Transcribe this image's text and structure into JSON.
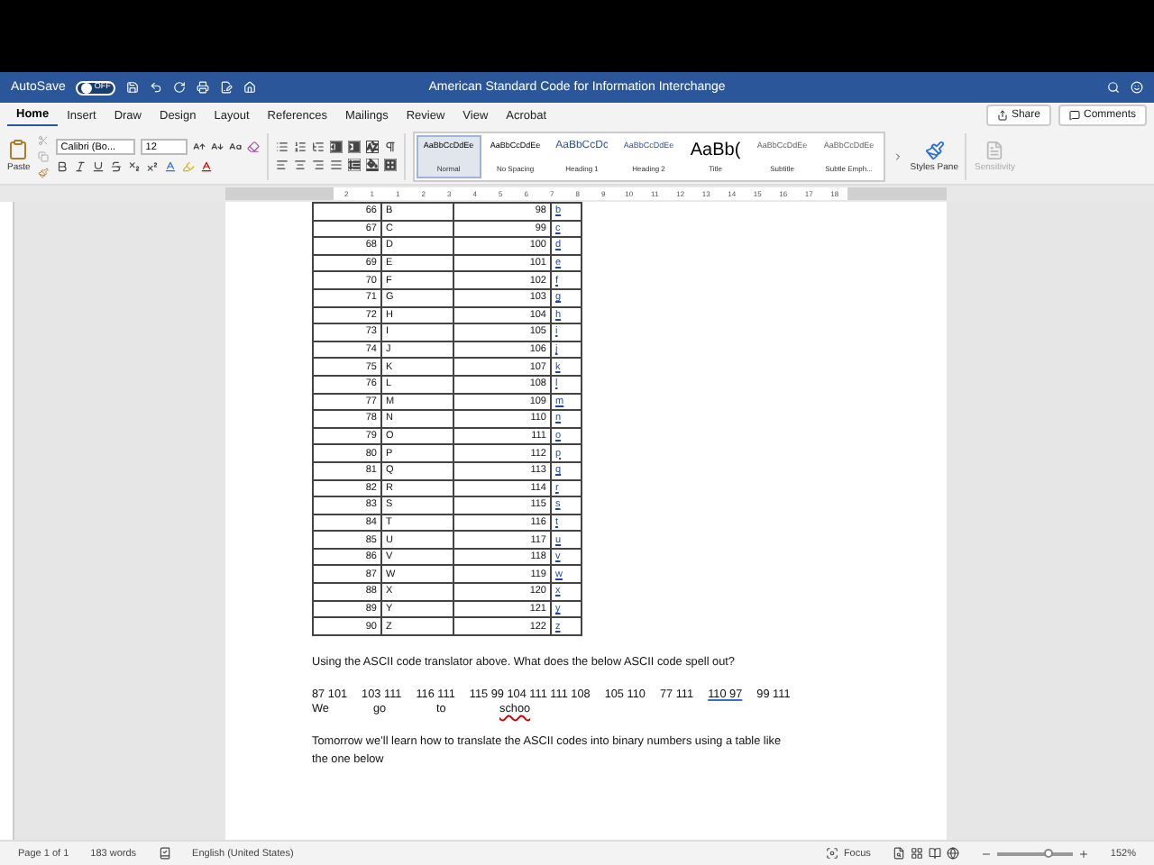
{
  "title_bar": {
    "autosave_label": "AutoSave",
    "autosave": {
      "on": false,
      "label": "OFF"
    },
    "title": "American Standard Code for Information Interchange"
  },
  "tabs": [
    {
      "label": "Home",
      "selected": true
    },
    {
      "label": "Insert",
      "selected": false
    },
    {
      "label": "Draw",
      "selected": false
    },
    {
      "label": "Design",
      "selected": false
    },
    {
      "label": "Layout",
      "selected": false
    },
    {
      "label": "References",
      "selected": false
    },
    {
      "label": "Mailings",
      "selected": false
    },
    {
      "label": "Review",
      "selected": false
    },
    {
      "label": "View",
      "selected": false
    },
    {
      "label": "Acrobat",
      "selected": false
    }
  ],
  "share_button": "Share",
  "comments_button": "Comments",
  "ribbon": {
    "paste_label": "Paste",
    "font_name": "Calibri (Bo...",
    "font_size": "12",
    "styles": [
      {
        "preview": "AaBbCcDdEe",
        "name": "Normal",
        "selected": true,
        "kind": "body"
      },
      {
        "preview": "AaBbCcDdEe",
        "name": "No Spacing",
        "selected": false,
        "kind": "body"
      },
      {
        "preview": "AaBbCcDc",
        "name": "Heading 1",
        "selected": false,
        "kind": "heading"
      },
      {
        "preview": "AaBbCcDdEe",
        "name": "Heading 2",
        "selected": false,
        "kind": "heading2"
      },
      {
        "preview": "AaBb(",
        "name": "Title",
        "selected": false,
        "kind": "title"
      },
      {
        "preview": "AaBbCcDdEe",
        "name": "Subtitle",
        "selected": false,
        "kind": "subtle"
      },
      {
        "preview": "AaBbCcDdEe",
        "name": "Subtle Emph...",
        "selected": false,
        "kind": "subtle"
      }
    ],
    "styles_pane": "Styles Pane",
    "sensitivity": {
      "label": "Sensitivity",
      "disabled": true
    }
  },
  "ruler": [
    "2",
    "1",
    "1",
    "2",
    "3",
    "4",
    "5",
    "6",
    "7",
    "8",
    "9",
    "10",
    "11",
    "12",
    "13",
    "14",
    "15",
    "16",
    "17",
    "18"
  ],
  "table": {
    "rows": [
      [
        "66",
        "B",
        "98",
        "b"
      ],
      [
        "67",
        "C",
        "99",
        "c"
      ],
      [
        "68",
        "D",
        "100",
        "d"
      ],
      [
        "69",
        "E",
        "101",
        "e"
      ],
      [
        "70",
        "F",
        "102",
        "f"
      ],
      [
        "71",
        "G",
        "103",
        "g"
      ],
      [
        "72",
        "H",
        "104",
        "h"
      ],
      [
        "73",
        "I",
        "105",
        "i"
      ],
      [
        "74",
        "J",
        "106",
        "j"
      ],
      [
        "75",
        "K",
        "107",
        "k"
      ],
      [
        "76",
        "L",
        "108",
        "l"
      ],
      [
        "77",
        "M",
        "109",
        "m"
      ],
      [
        "78",
        "N",
        "110",
        "n"
      ],
      [
        "79",
        "O",
        "111",
        "o"
      ],
      [
        "80",
        "P",
        "112",
        "p"
      ],
      [
        "81",
        "Q",
        "113",
        "q"
      ],
      [
        "82",
        "R",
        "114",
        "r"
      ],
      [
        "83",
        "S",
        "115",
        "s"
      ],
      [
        "84",
        "T",
        "116",
        "t"
      ],
      [
        "85",
        "U",
        "117",
        "u"
      ],
      [
        "86",
        "V",
        "118",
        "v"
      ],
      [
        "87",
        "W",
        "119",
        "w"
      ],
      [
        "88",
        "X",
        "120",
        "x"
      ],
      [
        "89",
        "Y",
        "121",
        "y"
      ],
      [
        "90",
        "Z",
        "122",
        "z"
      ]
    ]
  },
  "question": "Using the ASCII code translator above. What does the below ASCII code spell out?",
  "code_groups": [
    {
      "text": "87 101",
      "flagged": false
    },
    {
      "text": "103 111",
      "flagged": false
    },
    {
      "text": "116 111",
      "flagged": false
    },
    {
      "text": "115 99 104 111 111 108",
      "flagged": false
    },
    {
      "text": "105 110",
      "flagged": false
    },
    {
      "text": "77 111",
      "flagged": false
    },
    {
      "text": "110 97",
      "flagged": true
    },
    {
      "text": "99 111",
      "flagged": false
    }
  ],
  "answers": [
    {
      "text": "We",
      "misspelled": false
    },
    {
      "text": "go",
      "misspelled": false
    },
    {
      "text": "to",
      "misspelled": false
    },
    {
      "text": "schoo",
      "misspelled": true
    }
  ],
  "paragraph": "Tomorrow we’ll learn how to translate the ASCII codes into binary numbers using a table like",
  "paragraph_cut": "the one below",
  "status_bar": {
    "page": "Page 1 of 1",
    "words": "183 words",
    "language": "English (United States)",
    "focus": "Focus",
    "zoom": {
      "level": 0.68
    },
    "zoom_label": "152%"
  }
}
